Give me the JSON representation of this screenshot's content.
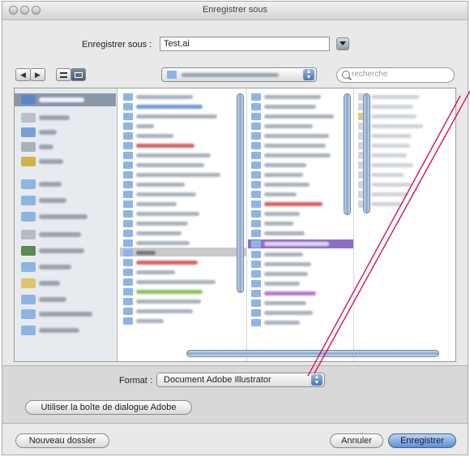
{
  "window": {
    "title": "Enregistrer sous",
    "save_as_label": "Enregistrer sous :",
    "filename_value": "Test.ai"
  },
  "toolbar": {
    "back_glyph": "◀",
    "forward_glyph": "▶",
    "location_value": "",
    "search_placeholder": "recherche"
  },
  "format": {
    "label": "Format :",
    "selected_value": "Document Adobe Illustrator"
  },
  "buttons": {
    "adobe_dialog": "Utiliser la boîte de dialogue Adobe",
    "new_folder": "Nouveau dossier",
    "cancel": "Annuler",
    "save": "Enregistrer"
  },
  "colors": {
    "accent_blue": "#5f8fd6",
    "annotation_line": "#d2145a"
  }
}
